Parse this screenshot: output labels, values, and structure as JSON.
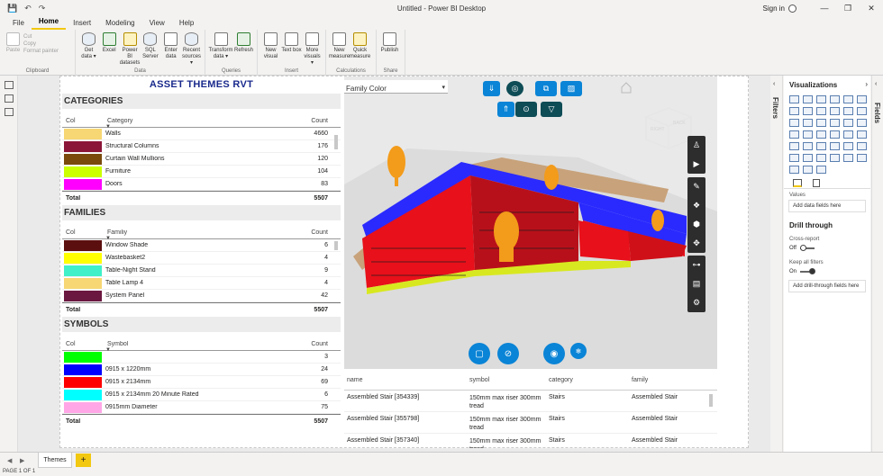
{
  "window": {
    "title": "Untitled - Power BI Desktop",
    "signin": "Sign in",
    "controls": {
      "minimize": "—",
      "restore": "❐",
      "close": "✕"
    },
    "quick_access": {
      "save": "💾",
      "undo": "↶",
      "redo": "↷"
    }
  },
  "menu": [
    {
      "label": "File"
    },
    {
      "label": "Home",
      "active": true
    },
    {
      "label": "Insert"
    },
    {
      "label": "Modeling"
    },
    {
      "label": "View"
    },
    {
      "label": "Help"
    }
  ],
  "ribbon": {
    "clipboard": {
      "label": "Clipboard",
      "paste": "Paste",
      "cut": "Cut",
      "copy": "Copy",
      "format_painter": "Format painter"
    },
    "data": {
      "label": "Data",
      "items": [
        "Get data ▾",
        "Excel",
        "Power BI datasets",
        "SQL Server",
        "Enter data",
        "Recent sources ▾"
      ]
    },
    "queries": {
      "label": "Queries",
      "items": [
        "Transform data ▾",
        "Refresh"
      ]
    },
    "insert": {
      "label": "Insert",
      "items": [
        "New visual",
        "Text box",
        "More visuals ▾"
      ]
    },
    "calculations": {
      "label": "Calculations",
      "items": [
        "New measure",
        "Quick measure"
      ]
    },
    "share": {
      "label": "Share",
      "items": [
        "Publish"
      ]
    }
  },
  "report": {
    "title": "ASSET THEMES RVT",
    "categories": {
      "heading": "CATEGORIES",
      "col_header": "Col",
      "name_header": "Category",
      "count_header": "Count",
      "rows": [
        {
          "color": "#f7d774",
          "name": "Walls",
          "count": "4660"
        },
        {
          "color": "#8b1538",
          "name": "Structural Columns",
          "count": "176"
        },
        {
          "color": "#7a4a0c",
          "name": "Curtain Wall Mullions",
          "count": "120"
        },
        {
          "color": "#ccff00",
          "name": "Furniture",
          "count": "104"
        },
        {
          "color": "#ff00ff",
          "name": "Doors",
          "count": "83"
        }
      ],
      "total_label": "Total",
      "total": "5507"
    },
    "families": {
      "heading": "FAMILIES",
      "col_header": "Col",
      "name_header": "Familiy",
      "count_header": "Count",
      "rows": [
        {
          "color": "#5c0f0f",
          "name": "Window Shade",
          "count": "6"
        },
        {
          "color": "#ffff00",
          "name": "Wastebasket2",
          "count": "4"
        },
        {
          "color": "#40f0c8",
          "name": "Table-Night Stand",
          "count": "9"
        },
        {
          "color": "#f7d774",
          "name": "Table Lamp 4",
          "count": "4"
        },
        {
          "color": "#6b1840",
          "name": "System Panel",
          "count": "42"
        }
      ],
      "total_label": "Total",
      "total": "5507"
    },
    "symbols": {
      "heading": "SYMBOLS",
      "col_header": "Col",
      "name_header": "Symbol",
      "count_header": "Count",
      "rows": [
        {
          "color": "#00ff00",
          "name": "",
          "count": "3"
        },
        {
          "color": "#0000ff",
          "name": "0915 x 1220mm",
          "count": "24"
        },
        {
          "color": "#ff0000",
          "name": "0915 x 2134mm",
          "count": "69"
        },
        {
          "color": "#00ffff",
          "name": "0915 x 2134mm 20 Minute Rated",
          "count": "6"
        },
        {
          "color": "#ffa6e6",
          "name": "0915mm Diameter",
          "count": "75"
        }
      ],
      "total_label": "Total",
      "total": "5507"
    },
    "model": {
      "dropdown": "Family Color",
      "viewcube_right": "RIGHT",
      "viewcube_back": "BACK"
    },
    "properties": {
      "headers": [
        "name",
        "symbol",
        "category",
        "family"
      ],
      "rows": [
        {
          "name": "Assembled Stair [354339]",
          "symbol": "150mm max riser 300mm tread",
          "category": "Stairs",
          "family": "Assembled Stair"
        },
        {
          "name": "Assembled Stair [355798]",
          "symbol": "150mm max riser 300mm tread",
          "category": "Stairs",
          "family": "Assembled Stair"
        },
        {
          "name": "Assembled Stair [357340]",
          "symbol": "150mm max riser 300mm tread",
          "category": "Stairs",
          "family": "Assembled Stair"
        }
      ]
    }
  },
  "panes": {
    "filters": "Filters",
    "visualizations": "Visualizations",
    "fields": "Fields",
    "values_label": "Values",
    "values_placeholder": "Add data fields here",
    "drill_through": "Drill through",
    "cross_report": "Cross-report",
    "cross_report_state": "Off",
    "keep_filters": "Keep all filters",
    "keep_filters_state": "On",
    "drill_placeholder": "Add drill-through fields here"
  },
  "tabs": {
    "page": "Themes",
    "add": "+",
    "prev": "◀",
    "next": "▶"
  },
  "status": "PAGE 1 OF 1"
}
